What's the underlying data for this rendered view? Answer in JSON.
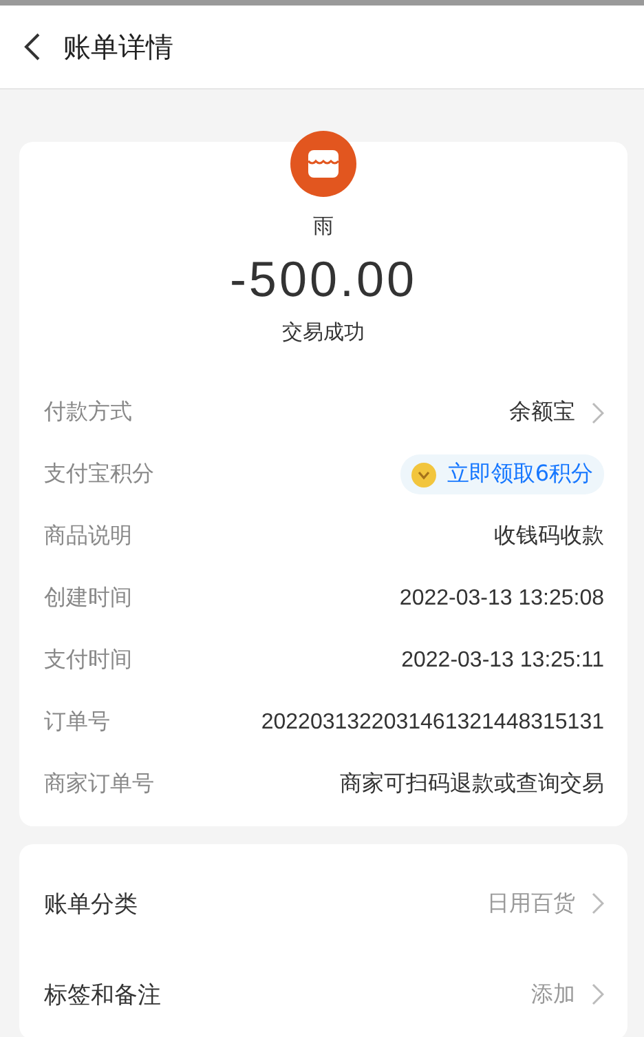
{
  "header": {
    "title": "账单详情"
  },
  "summary": {
    "merchant": "雨",
    "amount": "-500.00",
    "status": "交易成功"
  },
  "details": [
    {
      "kind": "link",
      "label": "付款方式",
      "value": "余额宝"
    },
    {
      "kind": "points",
      "label": "支付宝积分",
      "value": "立即领取6积分"
    },
    {
      "kind": "plain",
      "label": "商品说明",
      "value": "收钱码收款"
    },
    {
      "kind": "plain",
      "label": "创建时间",
      "value": "2022-03-13 13:25:08"
    },
    {
      "kind": "plain",
      "label": "支付时间",
      "value": "2022-03-13 13:25:11"
    },
    {
      "kind": "plain",
      "label": "订单号",
      "value": "2022031322031461321448315131"
    },
    {
      "kind": "plain",
      "label": "商家订单号",
      "value": "商家可扫码退款或查询交易"
    }
  ],
  "extras": [
    {
      "kind": "link",
      "label": "账单分类",
      "value": "日用百货"
    },
    {
      "kind": "link",
      "label": "标签和备注",
      "value": "添加"
    }
  ]
}
